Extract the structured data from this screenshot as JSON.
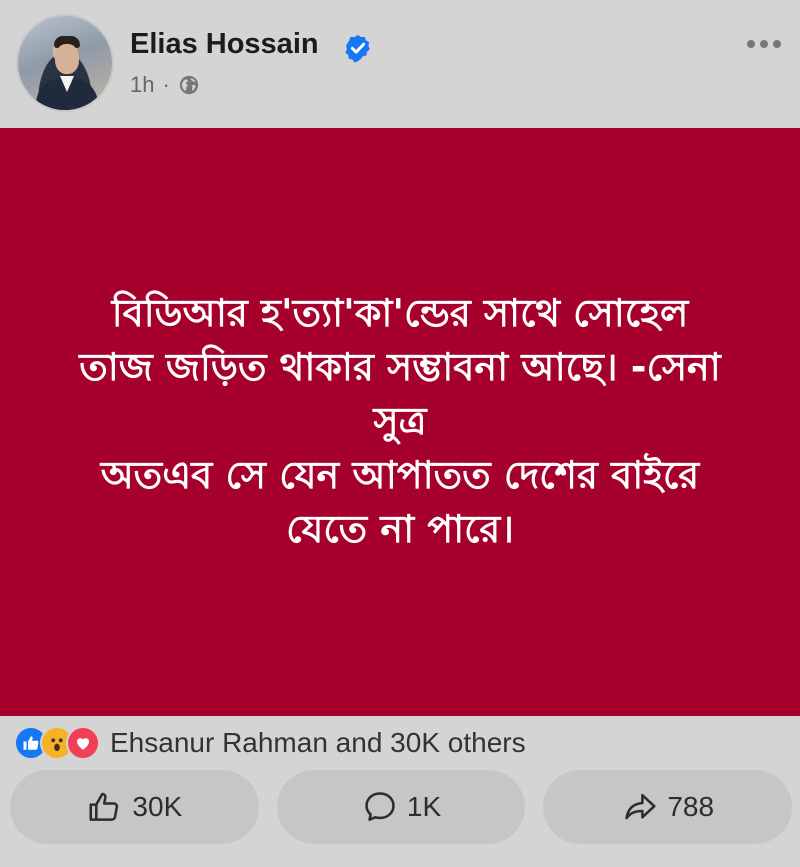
{
  "header": {
    "author_name": "Elias Hossain",
    "timestamp": "1h",
    "separator": "·",
    "privacy_icon": "globe-icon",
    "verified_icon": "verified-badge-icon",
    "menu_icon": "more-options-icon"
  },
  "post": {
    "background_color": "#a6002d",
    "text": "বিডিআর হ'ত্যা'কা'ন্ডের সাথে সোহেল\nতাজ জড়িত থাকার সম্ভাবনা আছে। -সেনা\nসুত্র\nঅতএব সে যেন আপাতত দেশের বাইরে\nযেতে না পারে।"
  },
  "reactions": {
    "icons": [
      "like-reaction-icon",
      "wow-reaction-icon",
      "love-reaction-icon"
    ],
    "summary": "Ehsanur Rahman and 30K others"
  },
  "actions": {
    "like": {
      "icon": "thumbs-up-icon",
      "count": "30K"
    },
    "comment": {
      "icon": "comment-icon",
      "count": "1K"
    },
    "share": {
      "icon": "share-icon",
      "count": "788"
    }
  }
}
